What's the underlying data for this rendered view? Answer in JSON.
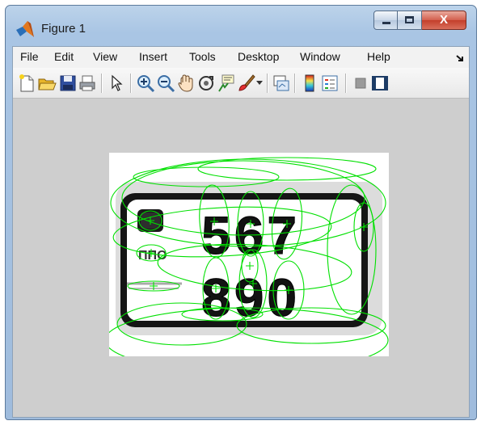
{
  "window": {
    "title": "Figure 1",
    "controls": {
      "minimize": "minimize",
      "maximize": "maximize",
      "close": "X"
    }
  },
  "menu": {
    "items": [
      "File",
      "Edit",
      "View",
      "Insert",
      "Tools",
      "Desktop",
      "Window",
      "Help"
    ],
    "overflow_icon": "dock-arrow-icon"
  },
  "toolbar": {
    "buttons": [
      "new-figure-icon",
      "open-file-icon",
      "save-icon",
      "print-icon",
      "pointer-icon",
      "zoom-in-icon",
      "zoom-out-icon",
      "pan-icon",
      "rotate-3d-icon",
      "data-cursor-icon",
      "brush-icon",
      "link-plot-icon",
      "colorbar-icon",
      "legend-icon",
      "hide-plot-tools-icon",
      "show-plot-tools-icon"
    ]
  },
  "figure": {
    "plate_text": {
      "top_row": "567",
      "bottom_row": "890",
      "small_label": "ΠΠΟ"
    },
    "colors": {
      "overlay": "#00e000",
      "figure_background": "#cecece",
      "plate_dark": "#141414"
    }
  }
}
